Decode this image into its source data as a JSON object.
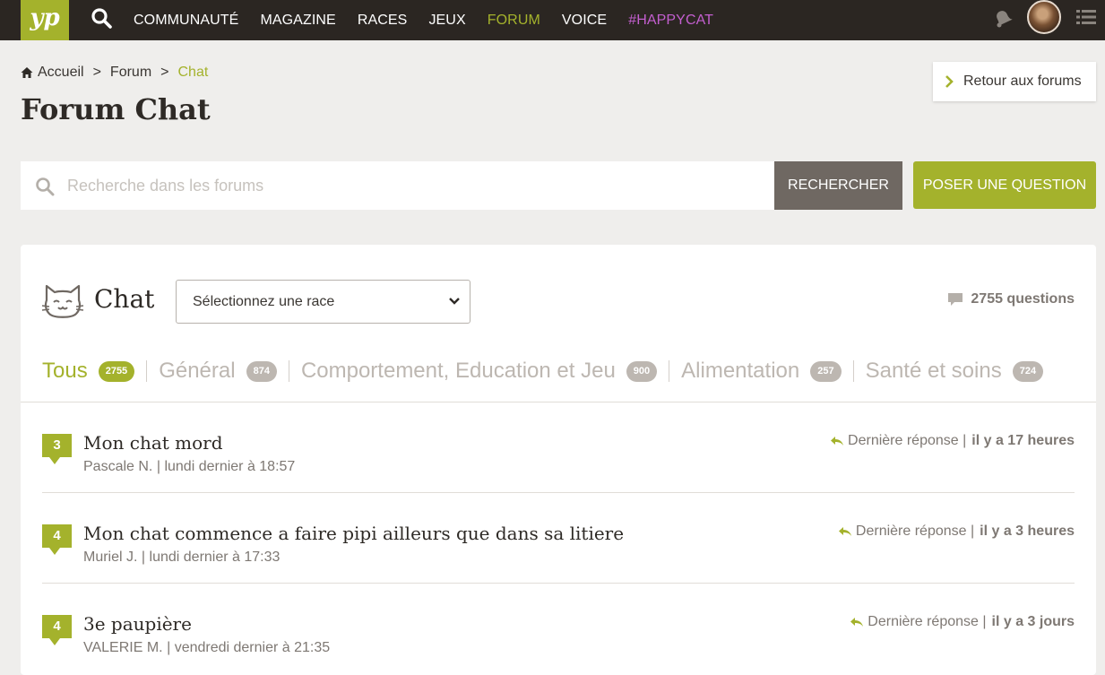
{
  "nav": {
    "logo": "yp",
    "items": [
      {
        "label": "COMMUNAUTÉ",
        "name": "nav-communaute",
        "state": ""
      },
      {
        "label": "MAGAZINE",
        "name": "nav-magazine",
        "state": ""
      },
      {
        "label": "RACES",
        "name": "nav-races",
        "state": ""
      },
      {
        "label": "JEUX",
        "name": "nav-jeux",
        "state": ""
      },
      {
        "label": "FORUM",
        "name": "nav-forum",
        "state": "active"
      },
      {
        "label": "VOICE",
        "name": "nav-voice",
        "state": ""
      },
      {
        "label": "#HAPPYCAT",
        "name": "nav-happycat",
        "state": "happy"
      }
    ]
  },
  "breadcrumb": {
    "home": "Accueil",
    "sep": ">",
    "forum": "Forum",
    "current": "Chat"
  },
  "page": {
    "title": "Forum Chat",
    "back_label": "Retour aux forums"
  },
  "search": {
    "placeholder": "Recherche dans les forums",
    "button": "RECHERCHER",
    "ask_button": "POSER UNE QUESTION"
  },
  "card": {
    "title": "Chat",
    "race_select": "Sélectionnez une race",
    "question_count": "2755 questions",
    "tabs": [
      {
        "label": "Tous",
        "count": "2755"
      },
      {
        "label": "Général",
        "count": "874"
      },
      {
        "label": "Comportement, Education et Jeu",
        "count": "900"
      },
      {
        "label": "Alimentation",
        "count": "257"
      },
      {
        "label": "Santé et soins",
        "count": "724"
      }
    ],
    "threads": [
      {
        "count": "3",
        "title": "Mon chat mord",
        "author": "Pascale N.",
        "date": "lundi dernier à 18:57",
        "last_label": "Dernière réponse",
        "last_time": "il y a 17 heures"
      },
      {
        "count": "4",
        "title": "Mon chat commence a faire pipi ailleurs que dans sa litiere",
        "author": "Muriel J.",
        "date": "lundi dernier à 17:33",
        "last_label": "Dernière réponse",
        "last_time": "il y a 3 heures"
      },
      {
        "count": "4",
        "title": "3e paupière",
        "author": "VALERIE M.",
        "date": "vendredi dernier à 21:35",
        "last_label": "Dernière réponse",
        "last_time": "il y a 3 jours"
      }
    ]
  },
  "colors": {
    "accent": "#a4b22c",
    "topbar": "#2b2622",
    "happycat": "#c35fcf",
    "search_button": "#6f6862"
  },
  "icons": [
    "search-icon",
    "bell-icon",
    "avatar",
    "list-menu-icon",
    "home-icon",
    "chevron-right-icon",
    "chevron-down-icon",
    "comment-icon",
    "cat-icon",
    "reply-icon"
  ]
}
